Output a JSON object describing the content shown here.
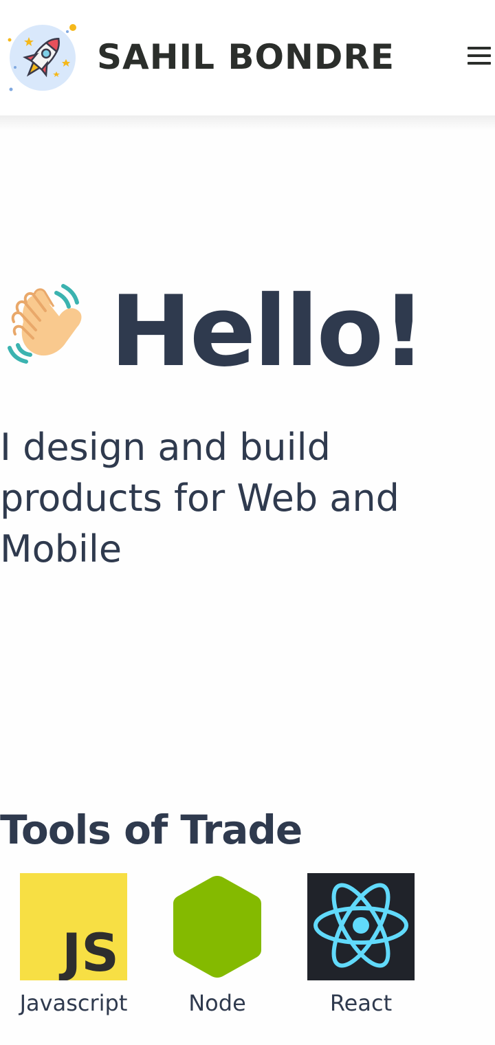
{
  "header": {
    "brand": "SAHIL BONDRE",
    "logo_icon": "rocket-icon",
    "menu_icon": "hamburger-menu-icon"
  },
  "hero": {
    "greeting": "Hello!",
    "wave_icon": "waving-hand-icon",
    "tagline": "I design and build products for Web and Mobile"
  },
  "tools": {
    "title": "Tools of Trade",
    "items": [
      {
        "label": "Javascript",
        "icon": "javascript-icon",
        "icon_text": "JS"
      },
      {
        "label": "Node",
        "icon": "nodejs-icon"
      },
      {
        "label": "React",
        "icon": "react-icon"
      }
    ]
  },
  "colors": {
    "text_primary": "#2f3a4e",
    "brand_text": "#2b2e2b",
    "js_yellow": "#f7df44",
    "node_green": "#84ba00",
    "react_cyan": "#61dafb",
    "react_bg": "#20232a"
  }
}
